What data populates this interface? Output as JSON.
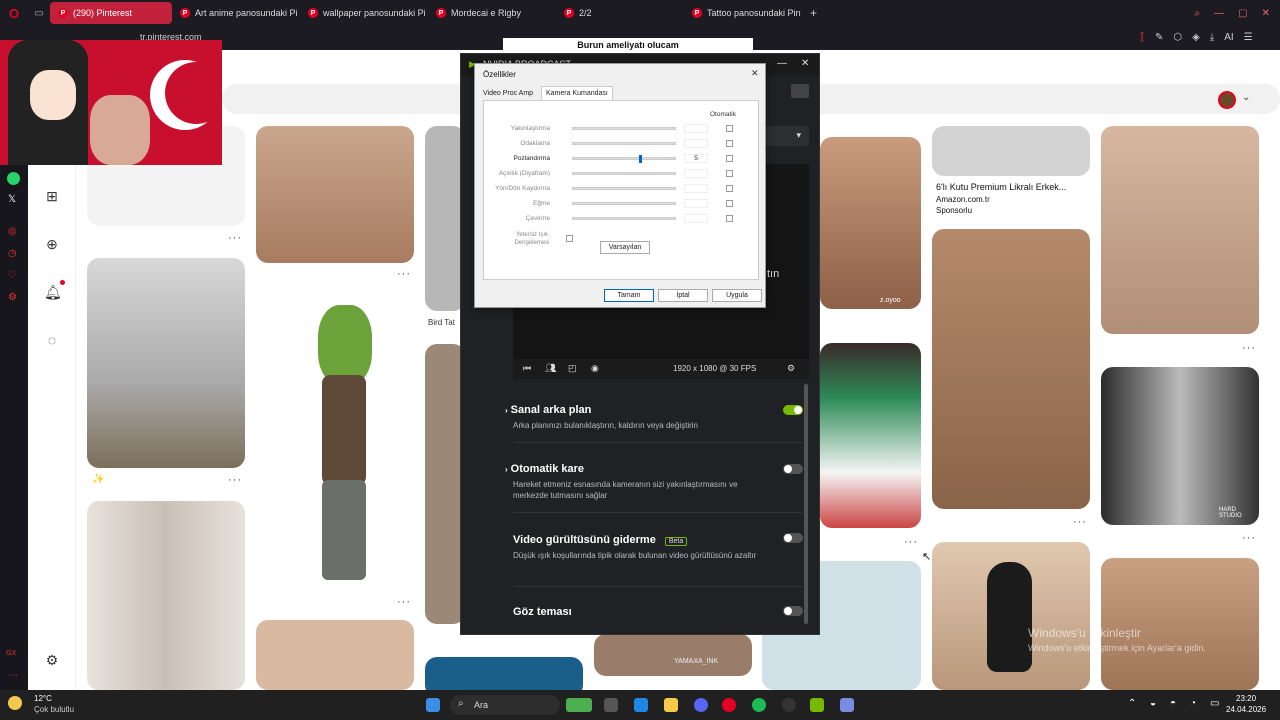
{
  "browser": {
    "tabs": [
      {
        "label": "(290) Pinterest",
        "active": true
      },
      {
        "label": "Art anime panosundaki Pi"
      },
      {
        "label": "wallpaper panosundaki Pi"
      },
      {
        "label": "Mordecai e Rigby"
      },
      {
        "label": "2/2"
      },
      {
        "label": "Tattoo panosundaki Pin"
      }
    ],
    "url": "tr.pinterest.com"
  },
  "overlay_caption": "Burun ameliyatı olucam",
  "pins": {
    "bird_label": "Bird Tat",
    "ad": {
      "title": "6'lı Kutu Premium Likralı Erkek...",
      "store": "Amazon.com.tr",
      "sponsor": "Sponsorlu"
    },
    "watermark_1": "z.oyoo",
    "watermark_2": "YAMAXA_INK",
    "studio": "HARD STUDIO",
    "sticker": "✨"
  },
  "nvidia": {
    "app_title": "NVIDIA BROADCAST",
    "resolution": "1920 x 1080 @ 30 FPS",
    "partial_text": "tın",
    "features": [
      {
        "title": "Sanal arka plan",
        "desc": "Arka planınızı bulanıklaştırın, kaldırın veya değiştirin",
        "on": true
      },
      {
        "title": "Otomatik kare",
        "desc": "Hareket etmeniz esnasında kameranın sizi yakınlaştırmasını ve merkezde tutmasını sağlar",
        "on": false
      },
      {
        "title": "Video gürültüsünü giderme",
        "badge": "Beta",
        "desc": "Düşük ışık koşullarında tipik olarak bulunan video gürültüsünü azaltır",
        "on": false
      },
      {
        "title": "Göz teması",
        "desc": "",
        "on": false
      }
    ]
  },
  "dialog": {
    "title": "Özellikler",
    "tabs": [
      "Video Proc Amp",
      "Kamera Kumandası"
    ],
    "auto_header": "Otomatik",
    "rows": [
      {
        "label": "Yakınlaştırma",
        "value": ""
      },
      {
        "label": "Odaklama",
        "value": ""
      },
      {
        "label": "Pozlandırma",
        "value": "5",
        "active": true,
        "level": 0.65
      },
      {
        "label": "Açıklık (Diyafram)",
        "value": ""
      },
      {
        "label": "Yön/Dön Kaydırma",
        "value": ""
      },
      {
        "label": "Eğme",
        "value": ""
      },
      {
        "label": "Çevirme",
        "value": ""
      }
    ],
    "low_light": "Yetersiz Işık Dengelemesi",
    "defaults_btn": "Varsayılan",
    "ok_btn": "Tamam",
    "cancel_btn": "İptal",
    "apply_btn": "Uygula"
  },
  "activation": {
    "line1": "Windows'u Etkinleştir",
    "line2": "Windows'u etkinleştirmek için Ayarlar'a gidin."
  },
  "taskbar": {
    "weather_temp": "12°C",
    "weather_desc": "Çok bulutlu",
    "search": "Ara",
    "time": "23:20",
    "date": "24.04.2026"
  },
  "colors": {
    "nvidia_green": "#76b900",
    "pinterest_red": "#e60023"
  }
}
